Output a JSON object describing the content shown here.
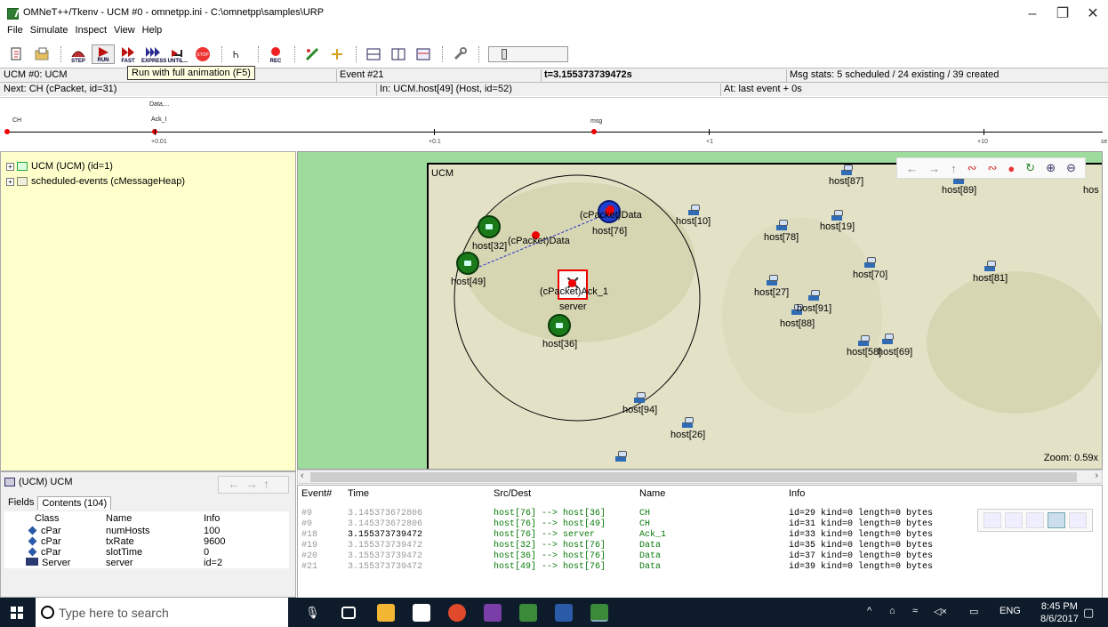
{
  "window": {
    "title": "OMNeT++/Tkenv - UCM #0 - omnetpp.ini - C:\\omnetpp\\samples\\URP",
    "minimize": "–",
    "maximize": "❐",
    "close": "✕"
  },
  "menu": [
    "File",
    "Simulate",
    "Inspect",
    "View",
    "Help"
  ],
  "toolbar": {
    "step": "STEP",
    "run": "RUN",
    "fast": "FAST",
    "express": "EXPRESS",
    "until": "UNTIL...",
    "stop": "STOP",
    "rec": "REC",
    "tooltip": "Run with full animation (F5)"
  },
  "status": {
    "row1": {
      "network": "UCM #0: UCM",
      "event": "Event #21",
      "time": "t=3.155373739472s",
      "msgstats": "Msg stats: 5 scheduled / 24 existing / 39 created"
    },
    "row2": {
      "next": "Next: CH (cPacket, id=31)",
      "in": "In: UCM.host[49] (Host, id=52)",
      "at": "At: last event + 0s"
    }
  },
  "timeline": {
    "events": [
      "CH",
      "Data,...",
      "Ack_I",
      "msg"
    ],
    "ticks": [
      "+0.01",
      "+0.1",
      "+1",
      "+10"
    ],
    "unit": "se"
  },
  "tree": {
    "items": [
      "UCM (UCM) (id=1)",
      "scheduled-events (cMessageHeap)"
    ]
  },
  "network": {
    "module_label": "UCM",
    "hosts": [
      "host[87]",
      "host[89]",
      "hos",
      "host[10]",
      "host[19]",
      "host[78]",
      "host[76]",
      "host[32]",
      "host[49]",
      "host[70]",
      "host[81]",
      "host[27]",
      "host[91]",
      "host[88]",
      "h",
      "server",
      "host[36]",
      "host[58]",
      "host[69]",
      "host[94]",
      "host[26]"
    ],
    "messages": [
      "(cPacket)Data",
      "(cPacket)Data",
      "(cPacket)Ack_1"
    ],
    "zoom": "Zoom: 0.59x"
  },
  "inspector": {
    "title": "(UCM) UCM",
    "tabs": [
      "Fields",
      "Contents (104)"
    ],
    "columns": [
      "Class",
      "Name",
      "Info"
    ],
    "rows": [
      {
        "class": "cPar",
        "name": "numHosts",
        "info": "100"
      },
      {
        "class": "cPar",
        "name": "txRate",
        "info": "9600"
      },
      {
        "class": "cPar",
        "name": "slotTime",
        "info": "0"
      },
      {
        "class": "Server",
        "name": "server",
        "info": "id=2"
      }
    ]
  },
  "eventlog": {
    "columns": [
      "Event#",
      "Time",
      "Src/Dest",
      "Name",
      "Info"
    ],
    "rows": [
      {
        "ev": "#9",
        "time": "3.145373672806",
        "src": "host[76] --> host[36]",
        "name": "CH",
        "info": "id=29  kind=0 length=0 bytes"
      },
      {
        "ev": "#9",
        "time": "3.145373672806",
        "src": "host[76] --> host[49]",
        "name": "CH",
        "info": "id=31  kind=0 length=0 bytes"
      },
      {
        "ev": "#18",
        "time": "3.155373739472",
        "src": "host[76] --> server",
        "name": "Ack_1",
        "info": "id=33  kind=0 length=0 bytes"
      },
      {
        "ev": "#19",
        "time": "3.155373739472",
        "src": "host[32] --> host[76]",
        "name": "Data",
        "info": "id=35  kind=0 length=0 bytes"
      },
      {
        "ev": "#20",
        "time": "3.155373739472",
        "src": "host[36] --> host[76]",
        "name": "Data",
        "info": "id=37  kind=0 length=0 bytes"
      },
      {
        "ev": "#21",
        "time": "3.155373739472",
        "src": "host[49] --> host[76]",
        "name": "Data",
        "info": "id=39  kind=0 length=0 bytes"
      }
    ]
  },
  "taskbar": {
    "search_placeholder": "Type here to search",
    "lang": "ENG",
    "time": "8:45 PM",
    "date": "8/6/2017"
  }
}
